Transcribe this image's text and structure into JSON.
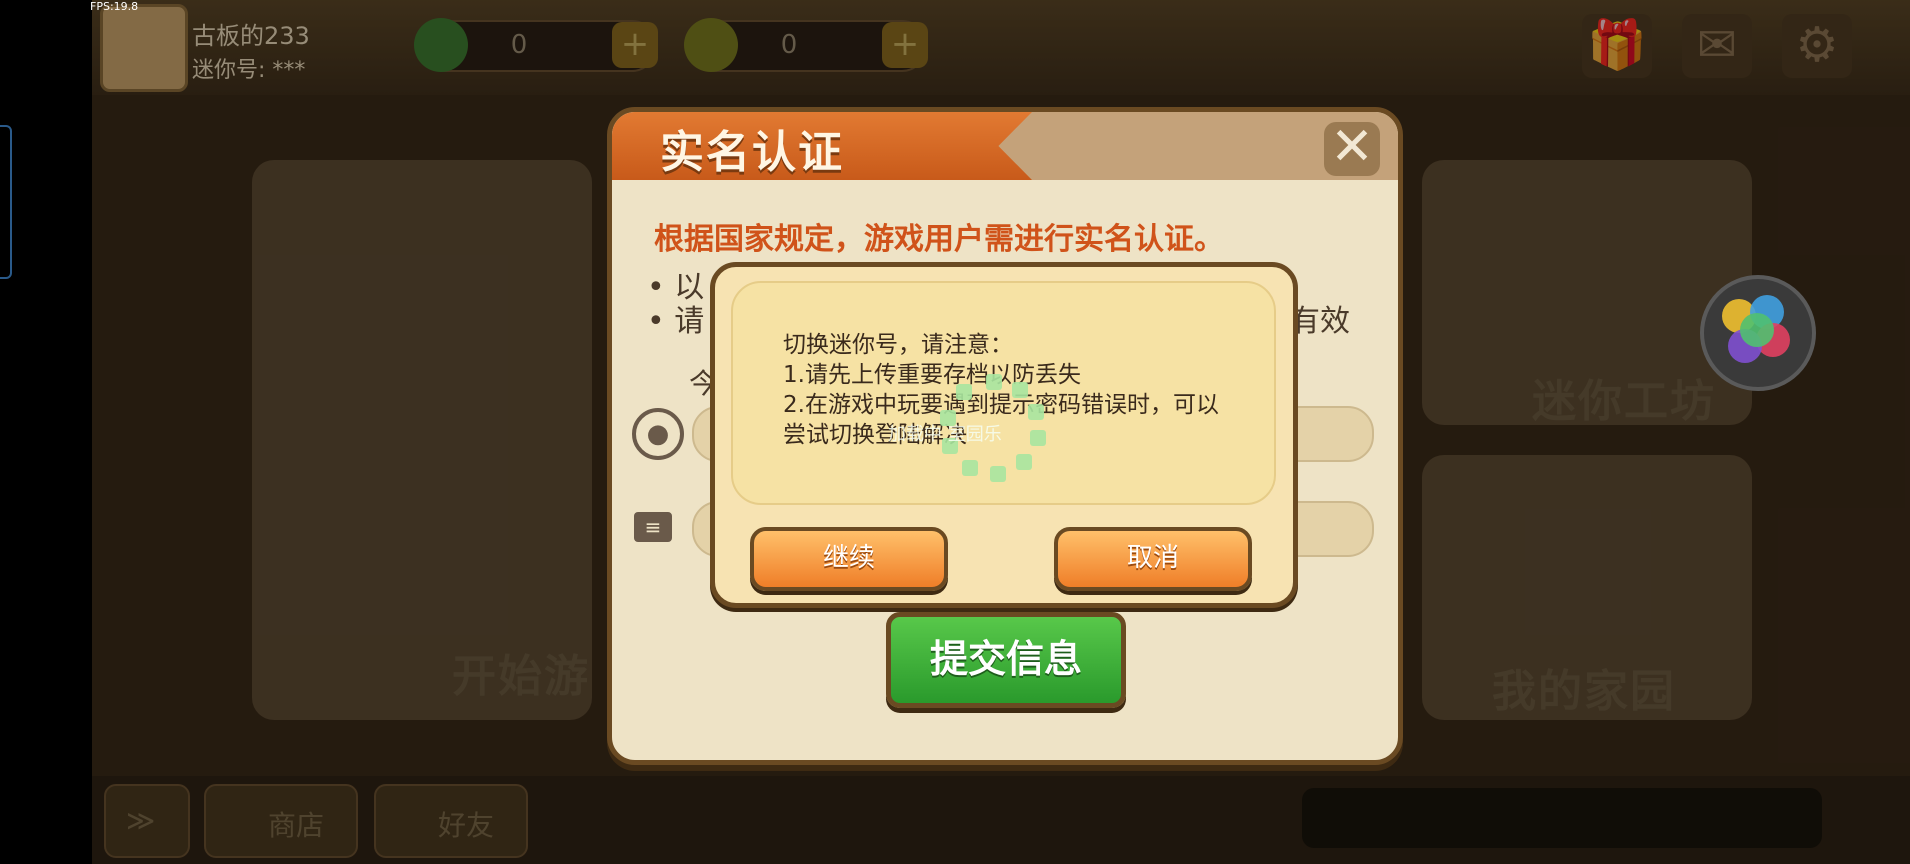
{
  "fps": "FPS:19.8",
  "player": {
    "name": "古板的233",
    "id_label": "迷你号: ***"
  },
  "resources": [
    {
      "value": "0"
    },
    {
      "value": "0"
    }
  ],
  "panels": {
    "start": "开始游",
    "workshop": "迷你工坊",
    "home": "我的家园"
  },
  "bottom": {
    "shop": "商店",
    "friends": "好友",
    "arrows": "≫"
  },
  "dialog": {
    "title": "实名认证",
    "notice": "根据国家规定，游戏用户需进行实名认证。",
    "rule1_start": "以",
    "rule2_start": "请",
    "rule2_end": "有效",
    "today": "今",
    "submit": "提交信息"
  },
  "confirm": {
    "line1": "切换迷你号，请注意：",
    "line2": "1.请先上传重要存档以防丢失",
    "line3": "2.在游戏中玩要遇到提示密码错误时，可以",
    "line4": "尝试切换登陆解决",
    "continue": "继续",
    "cancel": "取消"
  },
  "loading_text": "加载中 室园乐",
  "colors": {
    "accent_orange": "#e27a32",
    "notice_orange": "#d0531a",
    "submit_green": "#3aae38"
  },
  "icons": [
    "user-icon",
    "id-card-icon",
    "close-icon",
    "gift-icon",
    "mail-icon",
    "gear-icon"
  ]
}
